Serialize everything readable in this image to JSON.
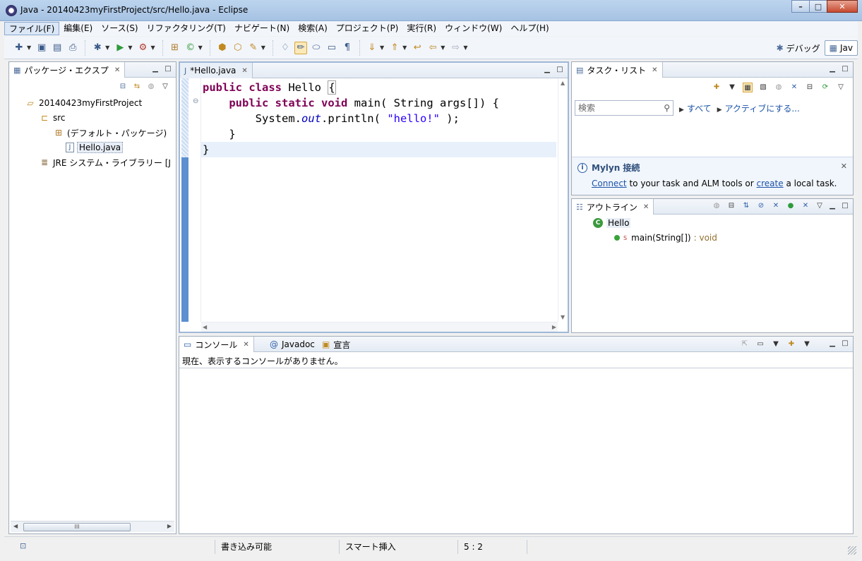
{
  "window": {
    "title": "Java - 20140423myFirstProject/src/Hello.java - Eclipse",
    "minimize": "–",
    "maximize": "□",
    "close": "✕"
  },
  "menu": {
    "items": [
      "ファイル(F)",
      "編集(E)",
      "ソース(S)",
      "リファクタリング(T)",
      "ナビゲート(N)",
      "検索(A)",
      "プロジェクト(P)",
      "実行(R)",
      "ウィンドウ(W)",
      "ヘルプ(H)"
    ]
  },
  "perspectives": {
    "debug": "デバッグ",
    "java": "Jav"
  },
  "package_explorer": {
    "tab_title": "パッケージ・エクスプ",
    "tree": [
      {
        "label": "20140423myFirstProject",
        "icon": "project-icon"
      },
      {
        "label": "src",
        "icon": "source-folder-icon"
      },
      {
        "label": "(デフォルト・パッケージ)",
        "icon": "package-icon"
      },
      {
        "label": "Hello.java",
        "icon": "java-file-icon"
      },
      {
        "label": "JRE システム・ライブラリー [J",
        "icon": "library-icon"
      }
    ],
    "scroll_thumb": "III"
  },
  "editor": {
    "tab_title": "*Hello.java",
    "code_lines": [
      "public class Hello {",
      "    public static void main( String args[]) {",
      "        System.out.println( \"hello!\" );",
      "    }",
      "}"
    ]
  },
  "task_list": {
    "tab_title": "タスク・リスト",
    "search_placeholder": "検索",
    "all_link": "すべて",
    "activate_link": "アクティブにする...",
    "mylyn_title": "Mylyn 接続",
    "mylyn_connect": "Connect",
    "mylyn_mid": "to your task and ALM tools or",
    "mylyn_create": "create",
    "mylyn_end": "a local task."
  },
  "outline": {
    "tab_title": "アウトライン",
    "class_name": "Hello",
    "method_name": "main(String[])",
    "method_return": ": void",
    "static_marker": "S"
  },
  "console": {
    "tabs": [
      "コンソール",
      "Javadoc",
      "宣言"
    ],
    "message": "現在、表示するコンソールがありません。"
  },
  "status": {
    "writable": "書き込み可能",
    "insert_mode": "スマート挿入",
    "position": "5 : 2"
  },
  "colors": {
    "keyword": "#7f0055",
    "string": "#2a00ff",
    "field": "#0000c0",
    "link": "#1a52a8"
  }
}
